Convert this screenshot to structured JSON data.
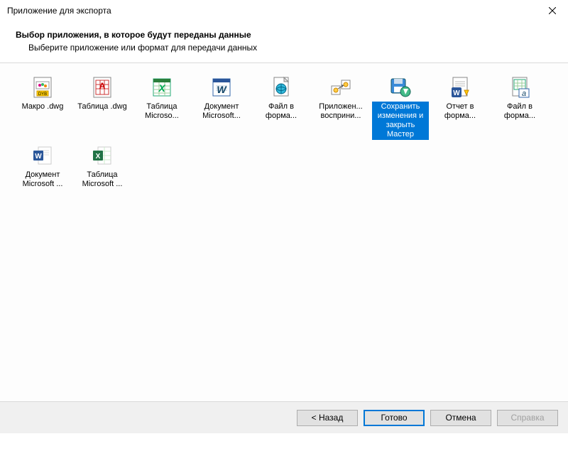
{
  "window": {
    "title": "Приложение для экспорта"
  },
  "header": {
    "title": "Выбор приложения, в которое будут переданы данные",
    "subtitle": "Выберите приложение или формат для передачи данных"
  },
  "items": [
    {
      "id": "macro-dwg",
      "icon": "dwg-macro",
      "label": "Макро .dwg",
      "selected": false
    },
    {
      "id": "table-dwg",
      "icon": "dwg-table",
      "label": "Таблица .dwg",
      "selected": false
    },
    {
      "id": "table-ms",
      "icon": "excel-xp",
      "label": "Таблица Microso...",
      "selected": false
    },
    {
      "id": "doc-ms",
      "icon": "word-xp",
      "label": "Документ Microsoft...",
      "selected": false
    },
    {
      "id": "file-fmt1",
      "icon": "file-globe",
      "label": "Файл в форма...",
      "selected": false
    },
    {
      "id": "app-perceive",
      "icon": "ole",
      "label": "Приложен... восприни...",
      "selected": false
    },
    {
      "id": "save-close",
      "icon": "save-wiz",
      "label": "Сохранить изменения и закрыть Мастер",
      "selected": true
    },
    {
      "id": "report-fmt",
      "icon": "word-rep",
      "label": "Отчет в форма...",
      "selected": false
    },
    {
      "id": "file-fmt2",
      "icon": "excel-a",
      "label": "Файл в форма...",
      "selected": false
    },
    {
      "id": "doc-ms2",
      "icon": "word-2013",
      "label": "Документ Microsoft ...",
      "selected": false
    },
    {
      "id": "table-ms2",
      "icon": "excel-2013",
      "label": "Таблица Microsoft ...",
      "selected": false
    }
  ],
  "footer": {
    "back": "< Назад",
    "finish": "Готово",
    "cancel": "Отмена",
    "help": "Справка"
  }
}
